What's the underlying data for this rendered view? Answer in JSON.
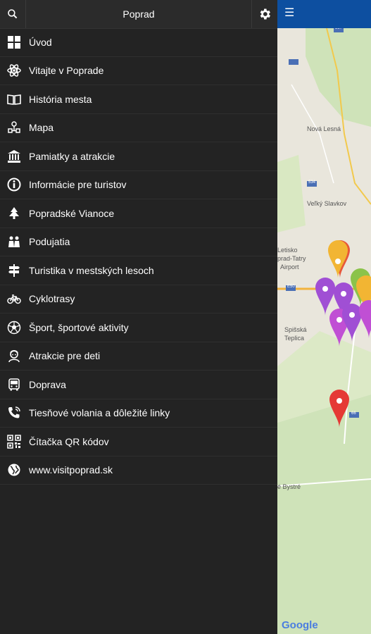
{
  "drawer": {
    "title": "Poprad",
    "search_icon": "search-icon",
    "settings_icon": "gear-icon",
    "items": [
      {
        "label": "Úvod",
        "icon": "grid-icon"
      },
      {
        "label": "Vitajte v Poprade",
        "icon": "atom-icon"
      },
      {
        "label": "História mesta",
        "icon": "open-book-icon"
      },
      {
        "label": "Mapa",
        "icon": "map-route-icon"
      },
      {
        "label": "Pamiatky a atrakcie",
        "icon": "museum-icon"
      },
      {
        "label": "Informácie pre turistov",
        "icon": "info-icon"
      },
      {
        "label": "Popradské Vianoce",
        "icon": "christmas-tree-icon"
      },
      {
        "label": "Podujatia",
        "icon": "people-icon"
      },
      {
        "label": "Turistika v mestských lesoch",
        "icon": "signpost-icon"
      },
      {
        "label": "Cyklotrasy",
        "icon": "bicycle-icon"
      },
      {
        "label": "Šport, športové aktivity",
        "icon": "ball-icon"
      },
      {
        "label": "Atrakcie pre deti",
        "icon": "child-icon"
      },
      {
        "label": "Doprava",
        "icon": "bus-icon"
      },
      {
        "label": "Tiesňové volania a dôležité linky",
        "icon": "phone-icon"
      },
      {
        "label": "Čítačka QR kódov",
        "icon": "qr-code-icon"
      },
      {
        "label": "www.visitpoprad.sk",
        "icon": "globe-icon"
      }
    ]
  },
  "map": {
    "menu_icon": "hamburger-icon",
    "labels": {
      "nova_lesna": "Nová Lesná",
      "velky_slavkov": "Veľký Slavkov",
      "letisko1": "Letisko",
      "letisko2": "prad-Tatry",
      "airport": "Airport",
      "spisska1": "Spišská",
      "spisska2": "Teplica",
      "bystre": "é Bystré",
      "road_537": "537",
      "road_534": "534",
      "road_e50": "E50",
      "road_66": "66"
    },
    "google": "Google"
  }
}
